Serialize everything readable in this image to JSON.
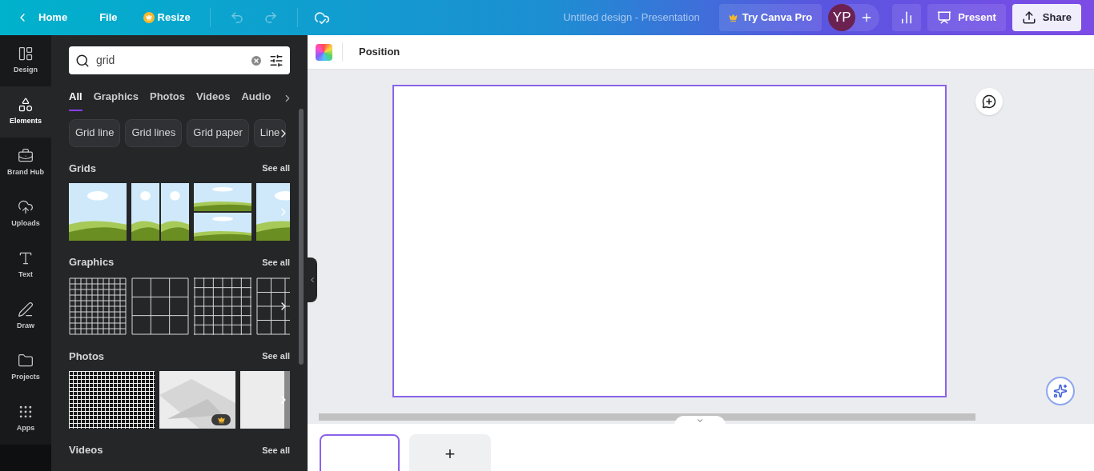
{
  "topbar": {
    "home": "Home",
    "file": "File",
    "resize": "Resize",
    "title": "Untitled design - Presentation",
    "try_pro": "Try Canva Pro",
    "avatar": "YP",
    "present": "Present",
    "share": "Share"
  },
  "rail": [
    {
      "label": "Design",
      "selected": false
    },
    {
      "label": "Elements",
      "selected": true
    },
    {
      "label": "Brand Hub",
      "selected": false
    },
    {
      "label": "Uploads",
      "selected": false
    },
    {
      "label": "Text",
      "selected": false
    },
    {
      "label": "Draw",
      "selected": false
    },
    {
      "label": "Projects",
      "selected": false
    },
    {
      "label": "Apps",
      "selected": false
    }
  ],
  "search": {
    "value": "grid"
  },
  "filter_tabs": [
    {
      "label": "All",
      "selected": true
    },
    {
      "label": "Graphics",
      "selected": false
    },
    {
      "label": "Photos",
      "selected": false
    },
    {
      "label": "Videos",
      "selected": false
    },
    {
      "label": "Audio",
      "selected": false
    }
  ],
  "chips": [
    "Grid line",
    "Grid lines",
    "Grid paper",
    "Line"
  ],
  "sections": [
    {
      "title": "Grids",
      "see_all": "See all",
      "kind": "grids",
      "items": [
        {
          "kind": "thumbnail",
          "premium": false
        },
        {
          "kind": "thumbnail",
          "premium": false
        },
        {
          "kind": "thumbnail",
          "premium": false
        },
        {
          "kind": "thumbnail"
        }
      ]
    },
    {
      "title": "Graphics",
      "see_all": "See all",
      "kind": "graphics",
      "items": [
        {
          "kind": "thumbnail",
          "premium": false
        },
        {
          "kind": "thumbnail",
          "premium": false
        },
        {
          "kind": "thumbnail",
          "premium": false
        },
        {
          "kind": "thumbnail"
        }
      ]
    },
    {
      "title": "Photos",
      "see_all": "See all",
      "kind": "photos",
      "items": [
        {
          "kind": "thumbnail",
          "premium": false
        },
        {
          "kind": "thumbnail",
          "premium": true
        },
        {
          "kind": "thumbnail",
          "premium": false
        }
      ]
    },
    {
      "title": "Videos",
      "see_all": "See all"
    }
  ],
  "toolbar": {
    "position": "Position"
  },
  "pages": [
    {
      "kind": "page",
      "selected": true
    },
    {
      "kind": "add",
      "label": "+"
    }
  ]
}
